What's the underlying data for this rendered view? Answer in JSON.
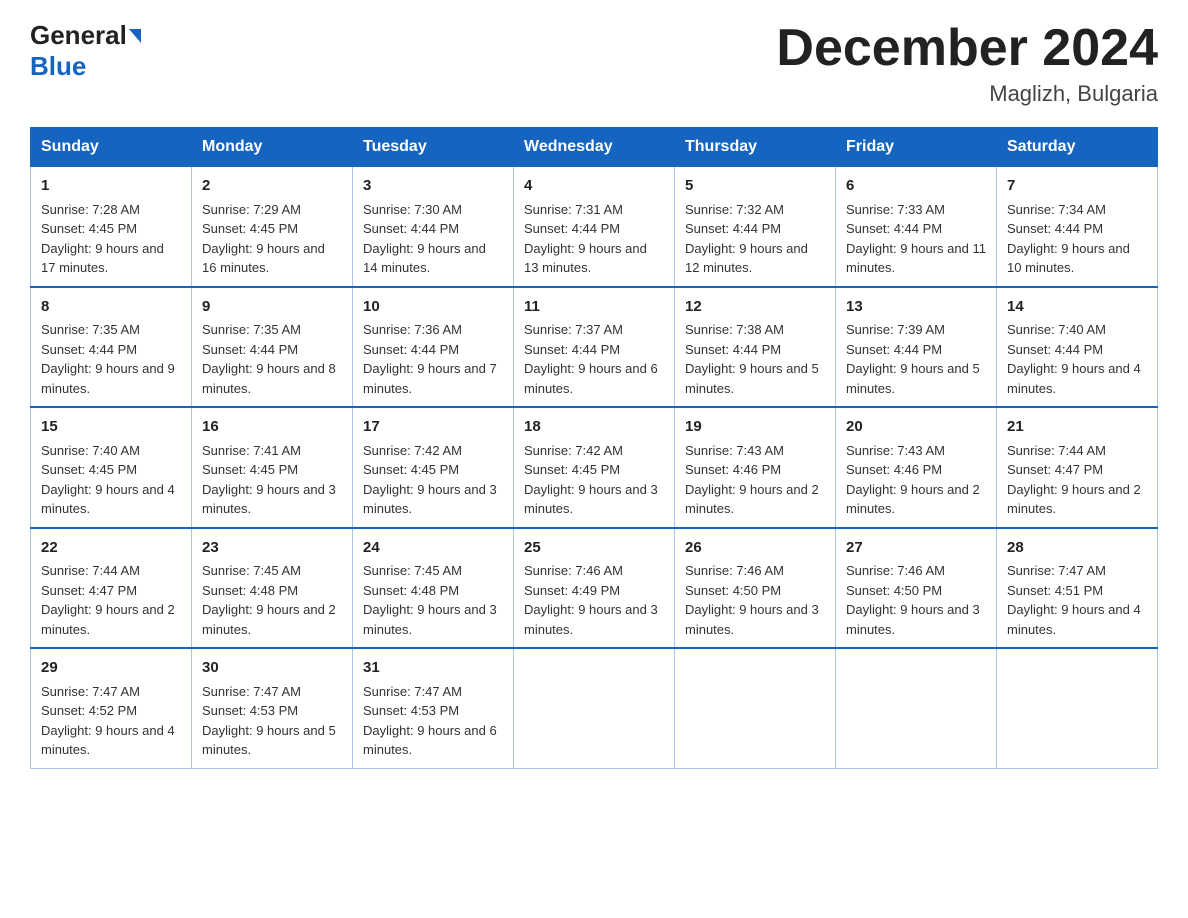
{
  "header": {
    "logo_line1": "General",
    "logo_line2": "Blue",
    "month_title": "December 2024",
    "location": "Maglizh, Bulgaria"
  },
  "days_of_week": [
    "Sunday",
    "Monday",
    "Tuesday",
    "Wednesday",
    "Thursday",
    "Friday",
    "Saturday"
  ],
  "weeks": [
    [
      {
        "day": "1",
        "sunrise": "7:28 AM",
        "sunset": "4:45 PM",
        "daylight": "9 hours and 17 minutes."
      },
      {
        "day": "2",
        "sunrise": "7:29 AM",
        "sunset": "4:45 PM",
        "daylight": "9 hours and 16 minutes."
      },
      {
        "day": "3",
        "sunrise": "7:30 AM",
        "sunset": "4:44 PM",
        "daylight": "9 hours and 14 minutes."
      },
      {
        "day": "4",
        "sunrise": "7:31 AM",
        "sunset": "4:44 PM",
        "daylight": "9 hours and 13 minutes."
      },
      {
        "day": "5",
        "sunrise": "7:32 AM",
        "sunset": "4:44 PM",
        "daylight": "9 hours and 12 minutes."
      },
      {
        "day": "6",
        "sunrise": "7:33 AM",
        "sunset": "4:44 PM",
        "daylight": "9 hours and 11 minutes."
      },
      {
        "day": "7",
        "sunrise": "7:34 AM",
        "sunset": "4:44 PM",
        "daylight": "9 hours and 10 minutes."
      }
    ],
    [
      {
        "day": "8",
        "sunrise": "7:35 AM",
        "sunset": "4:44 PM",
        "daylight": "9 hours and 9 minutes."
      },
      {
        "day": "9",
        "sunrise": "7:35 AM",
        "sunset": "4:44 PM",
        "daylight": "9 hours and 8 minutes."
      },
      {
        "day": "10",
        "sunrise": "7:36 AM",
        "sunset": "4:44 PM",
        "daylight": "9 hours and 7 minutes."
      },
      {
        "day": "11",
        "sunrise": "7:37 AM",
        "sunset": "4:44 PM",
        "daylight": "9 hours and 6 minutes."
      },
      {
        "day": "12",
        "sunrise": "7:38 AM",
        "sunset": "4:44 PM",
        "daylight": "9 hours and 5 minutes."
      },
      {
        "day": "13",
        "sunrise": "7:39 AM",
        "sunset": "4:44 PM",
        "daylight": "9 hours and 5 minutes."
      },
      {
        "day": "14",
        "sunrise": "7:40 AM",
        "sunset": "4:44 PM",
        "daylight": "9 hours and 4 minutes."
      }
    ],
    [
      {
        "day": "15",
        "sunrise": "7:40 AM",
        "sunset": "4:45 PM",
        "daylight": "9 hours and 4 minutes."
      },
      {
        "day": "16",
        "sunrise": "7:41 AM",
        "sunset": "4:45 PM",
        "daylight": "9 hours and 3 minutes."
      },
      {
        "day": "17",
        "sunrise": "7:42 AM",
        "sunset": "4:45 PM",
        "daylight": "9 hours and 3 minutes."
      },
      {
        "day": "18",
        "sunrise": "7:42 AM",
        "sunset": "4:45 PM",
        "daylight": "9 hours and 3 minutes."
      },
      {
        "day": "19",
        "sunrise": "7:43 AM",
        "sunset": "4:46 PM",
        "daylight": "9 hours and 2 minutes."
      },
      {
        "day": "20",
        "sunrise": "7:43 AM",
        "sunset": "4:46 PM",
        "daylight": "9 hours and 2 minutes."
      },
      {
        "day": "21",
        "sunrise": "7:44 AM",
        "sunset": "4:47 PM",
        "daylight": "9 hours and 2 minutes."
      }
    ],
    [
      {
        "day": "22",
        "sunrise": "7:44 AM",
        "sunset": "4:47 PM",
        "daylight": "9 hours and 2 minutes."
      },
      {
        "day": "23",
        "sunrise": "7:45 AM",
        "sunset": "4:48 PM",
        "daylight": "9 hours and 2 minutes."
      },
      {
        "day": "24",
        "sunrise": "7:45 AM",
        "sunset": "4:48 PM",
        "daylight": "9 hours and 3 minutes."
      },
      {
        "day": "25",
        "sunrise": "7:46 AM",
        "sunset": "4:49 PM",
        "daylight": "9 hours and 3 minutes."
      },
      {
        "day": "26",
        "sunrise": "7:46 AM",
        "sunset": "4:50 PM",
        "daylight": "9 hours and 3 minutes."
      },
      {
        "day": "27",
        "sunrise": "7:46 AM",
        "sunset": "4:50 PM",
        "daylight": "9 hours and 3 minutes."
      },
      {
        "day": "28",
        "sunrise": "7:47 AM",
        "sunset": "4:51 PM",
        "daylight": "9 hours and 4 minutes."
      }
    ],
    [
      {
        "day": "29",
        "sunrise": "7:47 AM",
        "sunset": "4:52 PM",
        "daylight": "9 hours and 4 minutes."
      },
      {
        "day": "30",
        "sunrise": "7:47 AM",
        "sunset": "4:53 PM",
        "daylight": "9 hours and 5 minutes."
      },
      {
        "day": "31",
        "sunrise": "7:47 AM",
        "sunset": "4:53 PM",
        "daylight": "9 hours and 6 minutes."
      },
      null,
      null,
      null,
      null
    ]
  ]
}
